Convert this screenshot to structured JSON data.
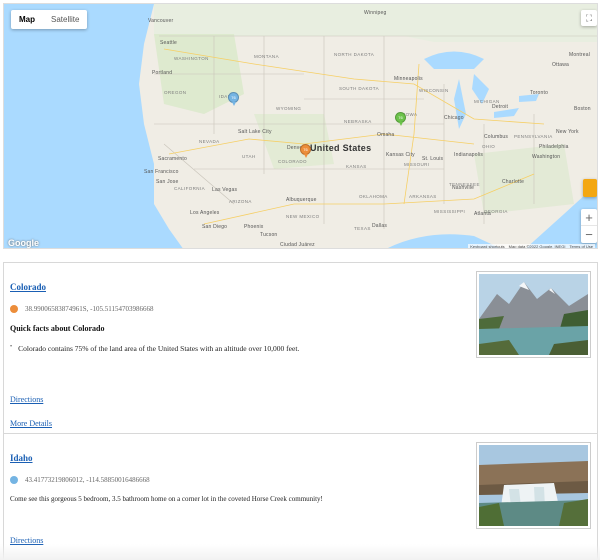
{
  "map": {
    "type_buttons": [
      "Map",
      "Satellite"
    ],
    "active_type": "Map",
    "country_label": "United States",
    "city_labels": {
      "vancouver": "Vancouver",
      "seattle": "Seattle",
      "portland": "Portland",
      "winnipeg": "Winnipeg",
      "minneapolis": "Minneapolis",
      "ottawa": "Ottawa",
      "montreal": "Montreal",
      "toronto": "Toronto",
      "detroit": "Detroit",
      "chicago": "Chicago",
      "boston": "Boston",
      "new_york": "New York",
      "philadelphia": "Philadelphia",
      "washington": "Washington",
      "saltlake": "Salt Lake City",
      "omaha": "Omaha",
      "kansas": "Kansas City",
      "stlouis": "St. Louis",
      "indianapolis": "Indianapolis",
      "columbus": "Columbus",
      "denver": "Denver",
      "sacramento": "Sacramento",
      "sanfrancisco": "San Francisco",
      "sanjose": "San Jose",
      "lasvegas": "Las Vegas",
      "losangeles": "Los Angeles",
      "sandiego": "San Diego",
      "phoenix": "Phoenix",
      "tucson": "Tucson",
      "albuquerque": "Albuquerque",
      "dallas": "Dallas",
      "nashville": "Nashville",
      "charlotte": "Charlotte",
      "atlanta": "Atlanta",
      "juarez": "Ciudad Juárez",
      "oklahoma": "OKLAHOMA"
    },
    "state_labels": {
      "wa": "WASHINGTON",
      "mt": "MONTANA",
      "nd": "NORTH DAKOTA",
      "or": "OREGON",
      "id": "IDAHO",
      "sd": "SOUTH DAKOTA",
      "wy": "WYOMING",
      "ne": "NEBRASKA",
      "ia": "IOWA",
      "nv": "NEVADA",
      "ut": "UTAH",
      "co": "COLORADO",
      "ks": "KANSAS",
      "mo": "MISSOURI",
      "ca": "CALIFORNIA",
      "az": "ARIZONA",
      "nm": "NEW MEXICO",
      "tx": "TEXAS",
      "ar": "ARKANSAS",
      "ms": "MISSISSIPPI",
      "tn": "TENNESSEE",
      "ga": "GEORGIA",
      "wi": "WISCONSIN",
      "mi": "MICHIGAN",
      "oh": "OHIO",
      "pa": "PENNSYLVANIA"
    },
    "markers": [
      {
        "count": "76",
        "color": "#74b4e3"
      },
      {
        "count": "76",
        "color": "#ec8d3a"
      },
      {
        "count": "76",
        "color": "#6cc24a"
      }
    ],
    "google": "Google",
    "attribution": [
      "Keyboard shortcuts",
      "Map data ©2022 Google, INEGI",
      "Terms of Use"
    ]
  },
  "locations": [
    {
      "name": "Colorado",
      "coords": "38.99006583874961S, -105.51154703986668",
      "pin_color": "#ec8d3a",
      "facts_heading": "Quick facts about Colorado",
      "facts": [
        "Colorado contains 75% of the land area of the United States with an altitude over 10,000 feet."
      ],
      "links": [
        "Directions",
        "More Details"
      ]
    },
    {
      "name": "Idaho",
      "coords": "43.41773219806012, -114.58850016486668",
      "pin_color": "#74b4e3",
      "description": "Come see this gorgeous 5 bedroom, 3.5 bathroom home on a corner lot in the coveted Horse Creek community!",
      "links": [
        "Directions"
      ]
    }
  ]
}
